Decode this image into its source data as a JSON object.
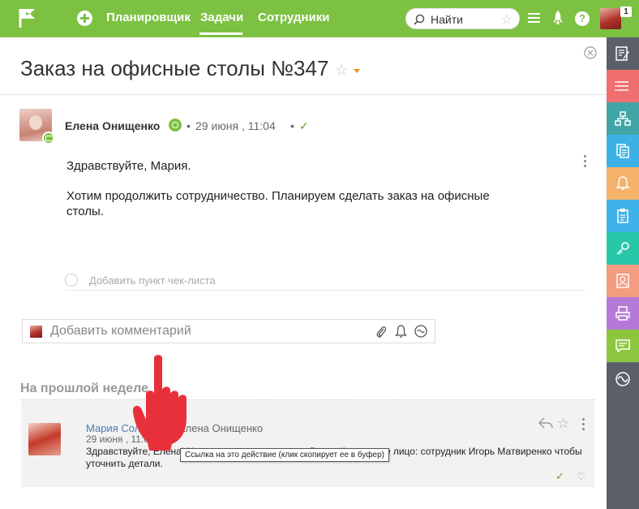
{
  "topbar": {
    "nav": [
      "Планировщик",
      "Задачи",
      "Сотрудники"
    ],
    "active_nav": "Задачи",
    "search_placeholder": "Найти",
    "notification_count": "1"
  },
  "task": {
    "title": "Заказ на офисные столы №347",
    "author": "Елена Онищенко",
    "date": "29 июня , 11:04",
    "body": [
      "Здравствуйте, Мария.",
      "Хотим продолжить сотрудничество. Планируем сделать заказ на офисные",
      "столы."
    ],
    "checklist_placeholder": "Добавить пункт чек-листа",
    "comment_placeholder": "Добавить комментарий"
  },
  "activity": {
    "section_title": "На прошлой неделе",
    "item": {
      "author": "Мария Соловьева",
      "arrow": "→",
      "target": "Елена Онищенко",
      "date": "29 июня , 11:04",
      "separator": "/",
      "hash": "#",
      "text": "Здравствуйте, Елена! Наш менеджер свяжется с Вами. Контактное лицо: сотрудник Игорь Матвиренко чтобы уточнить детали."
    },
    "tooltip": "Ссылка на это действие (клик скопирует ее в буфер)"
  },
  "colors": {
    "topbar": "#7dc142",
    "sidebar": "#5b5f69",
    "link": "#4b7cb3",
    "accent_orange": "#f28a1c"
  },
  "sidebar_icons": [
    "edit-icon",
    "list-icon",
    "structure-icon",
    "documents-icon",
    "bell-icon",
    "clipboard-icon",
    "key-icon",
    "contact-card-icon",
    "printer-icon",
    "chat-icon",
    "activity-icon"
  ]
}
